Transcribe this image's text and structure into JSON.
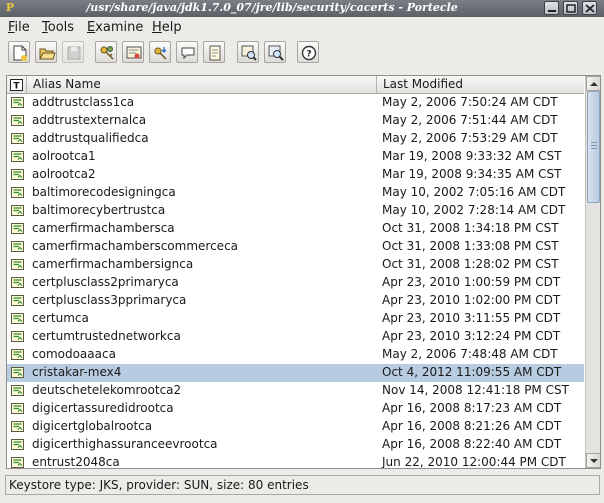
{
  "window": {
    "title": "/usr/share/java/jdk1.7.0_07/jre/lib/security/cacerts - Portecle"
  },
  "menu": {
    "items": [
      {
        "label": "File",
        "mnemonic": "F",
        "rest": "ile"
      },
      {
        "label": "Tools",
        "mnemonic": "T",
        "rest": "ools"
      },
      {
        "label": "Examine",
        "mnemonic": "E",
        "rest": "xamine"
      },
      {
        "label": "Help",
        "mnemonic": "H",
        "rest": "elp"
      }
    ]
  },
  "toolbar": {
    "buttons": [
      "new-keystore",
      "open-keystore",
      "save-keystore",
      "generate-key-pair",
      "import-trusted-certificate",
      "import-key-pair",
      "keystore-report",
      "set-password",
      "examine-certificate",
      "examine-crl",
      "help"
    ]
  },
  "table": {
    "columns": {
      "type": "T",
      "alias": "Alias Name",
      "modified": "Last Modified"
    },
    "rows": [
      {
        "alias": "addtrustclass1ca",
        "date": "May 2, 2006 7:50:24 AM CDT"
      },
      {
        "alias": "addtrustexternalca",
        "date": "May 2, 2006 7:51:44 AM CDT"
      },
      {
        "alias": "addtrustqualifiedca",
        "date": "May 2, 2006 7:53:29 AM CDT"
      },
      {
        "alias": "aolrootca1",
        "date": "Mar 19, 2008 9:33:32 AM CST"
      },
      {
        "alias": "aolrootca2",
        "date": "Mar 19, 2008 9:34:35 AM CST"
      },
      {
        "alias": "baltimorecodesigningca",
        "date": "May 10, 2002 7:05:16 AM CDT"
      },
      {
        "alias": "baltimorecybertrustca",
        "date": "May 10, 2002 7:28:14 AM CDT"
      },
      {
        "alias": "camerfirmachambersca",
        "date": "Oct 31, 2008 1:34:18 PM CST"
      },
      {
        "alias": "camerfirmachamberscommerceca",
        "date": "Oct 31, 2008 1:33:08 PM CST"
      },
      {
        "alias": "camerfirmachambersignca",
        "date": "Oct 31, 2008 1:28:02 PM CST"
      },
      {
        "alias": "certplusclass2primaryca",
        "date": "Apr 23, 2010 1:00:59 PM CDT"
      },
      {
        "alias": "certplusclass3pprimaryca",
        "date": "Apr 23, 2010 1:02:00 PM CDT"
      },
      {
        "alias": "certumca",
        "date": "Apr 23, 2010 3:11:55 PM CDT"
      },
      {
        "alias": "certumtrustednetworkca",
        "date": "Apr 23, 2010 3:12:24 PM CDT"
      },
      {
        "alias": "comodoaaaca",
        "date": "May 2, 2006 7:48:48 AM CDT"
      },
      {
        "alias": "cristakar-mex4",
        "date": "Oct 4, 2012 11:09:55 AM CDT",
        "selected": true
      },
      {
        "alias": "deutschetelekomrootca2",
        "date": "Nov 14, 2008 12:41:18 PM CST"
      },
      {
        "alias": "digicertassuredidrootca",
        "date": "Apr 16, 2008 8:17:23 AM CDT"
      },
      {
        "alias": "digicertglobalrootca",
        "date": "Apr 16, 2008 8:21:26 AM CDT"
      },
      {
        "alias": "digicerthighassuranceevrootca",
        "date": "Apr 16, 2008 8:22:40 AM CDT"
      },
      {
        "alias": "entrust2048ca",
        "date": "Jun 22, 2010 12:00:44 PM CDT"
      }
    ]
  },
  "status": {
    "text": "Keystore type: JKS, provider: SUN, size: 80 entries"
  },
  "colors": {
    "selection": "#b7cbe1",
    "certificate_icon": "#2f8f2f"
  }
}
